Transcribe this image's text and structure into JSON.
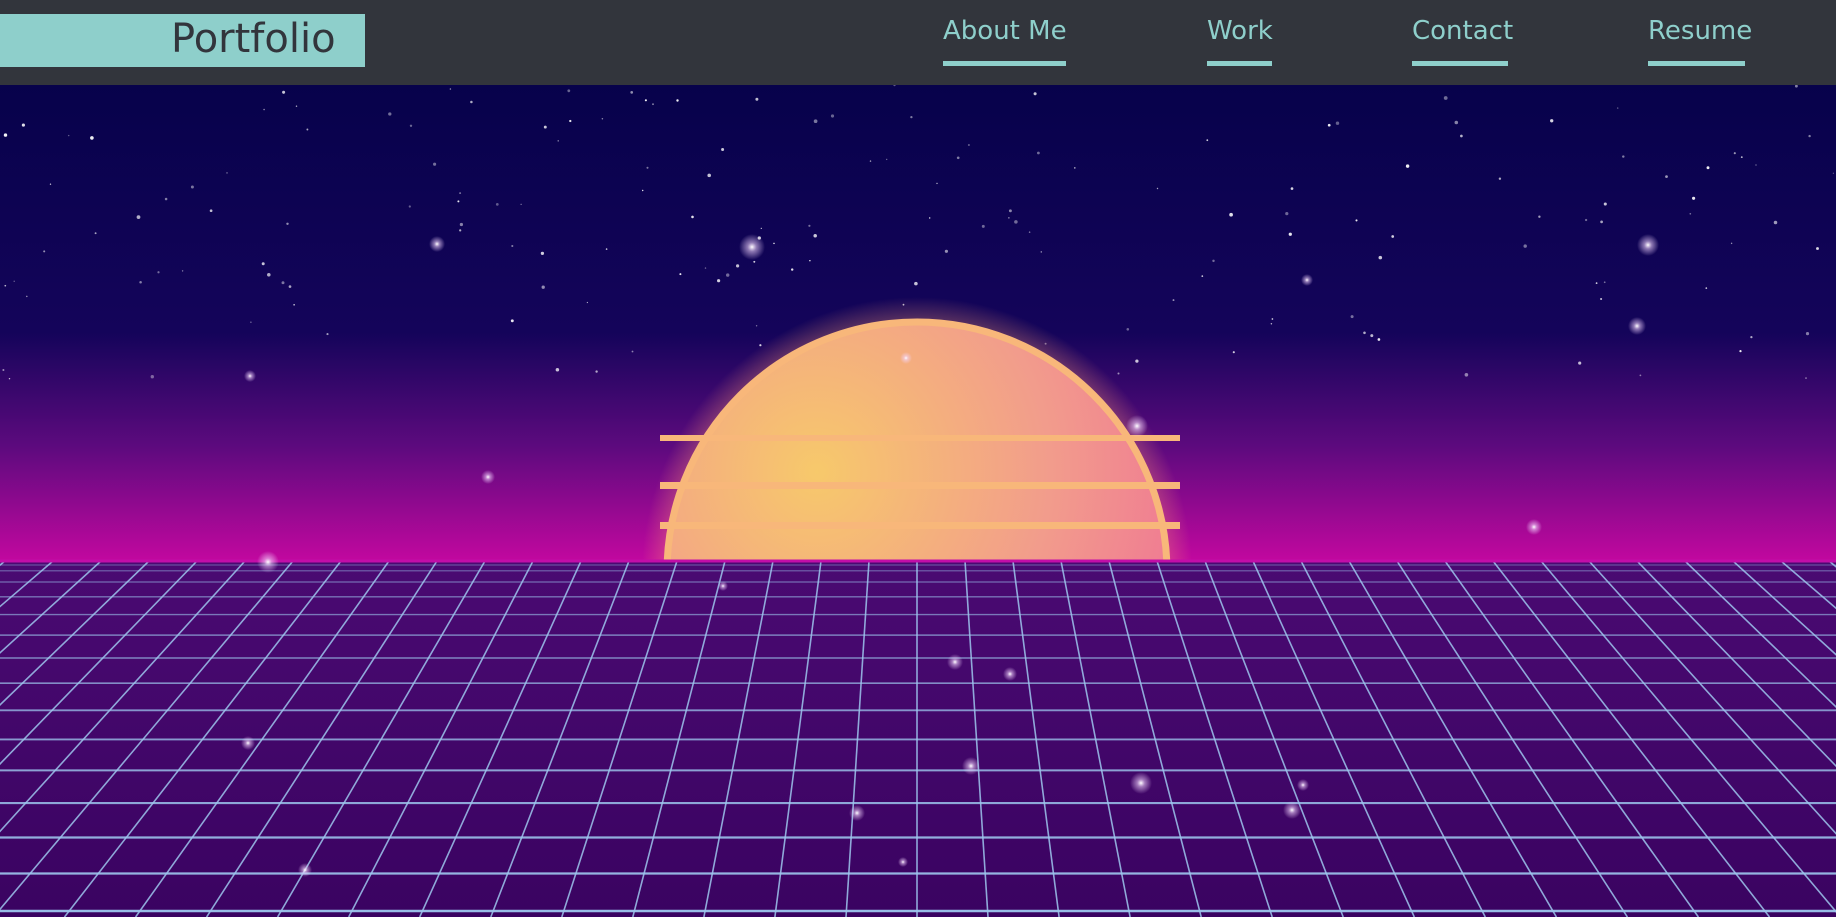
{
  "brand": {
    "title": "Portfolio"
  },
  "nav": {
    "items": [
      {
        "label": "About Me"
      },
      {
        "label": "Work"
      },
      {
        "label": "Contact"
      },
      {
        "label": "Resume"
      }
    ]
  },
  "hero": {
    "scene": "synthwave-sunset-grid",
    "colors": {
      "sky_top": "#07024b",
      "sky_horizon": "#c2089f",
      "sun_top": "#f7c96b",
      "sun_bottom": "#ef6d95",
      "sun_glow": "#ffb46a",
      "grid_floor": "#3a0361",
      "grid_line": "#9ec6ee"
    }
  }
}
